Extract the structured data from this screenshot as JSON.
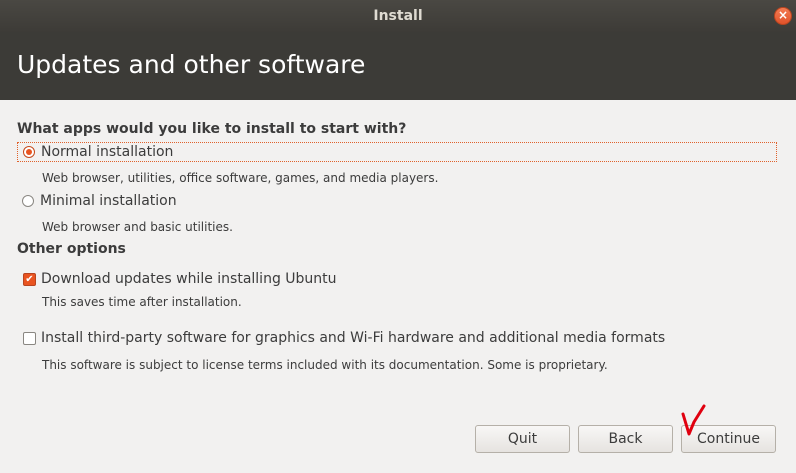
{
  "window": {
    "title": "Install"
  },
  "header": {
    "title": "Updates and other software"
  },
  "apps_section": {
    "question": "What apps would you like to install to start with?",
    "normal": {
      "label": "Normal installation",
      "description": "Web browser, utilities, office software, games, and media players.",
      "selected": true
    },
    "minimal": {
      "label": "Minimal installation",
      "description": "Web browser and basic utilities.",
      "selected": false
    }
  },
  "other_options": {
    "title": "Other options",
    "download_updates": {
      "label": "Download updates while installing Ubuntu",
      "description": "This saves time after installation.",
      "checked": true
    },
    "third_party": {
      "label": "Install third-party software for graphics and Wi-Fi hardware and additional media formats",
      "description": "This software is subject to license terms included with its documentation. Some is proprietary.",
      "checked": false
    }
  },
  "buttons": {
    "quit": "Quit",
    "back": "Back",
    "continue": "Continue"
  },
  "colors": {
    "accent": "#e95420",
    "header_bg": "#3c3b37",
    "annotation": "#e0000f"
  }
}
